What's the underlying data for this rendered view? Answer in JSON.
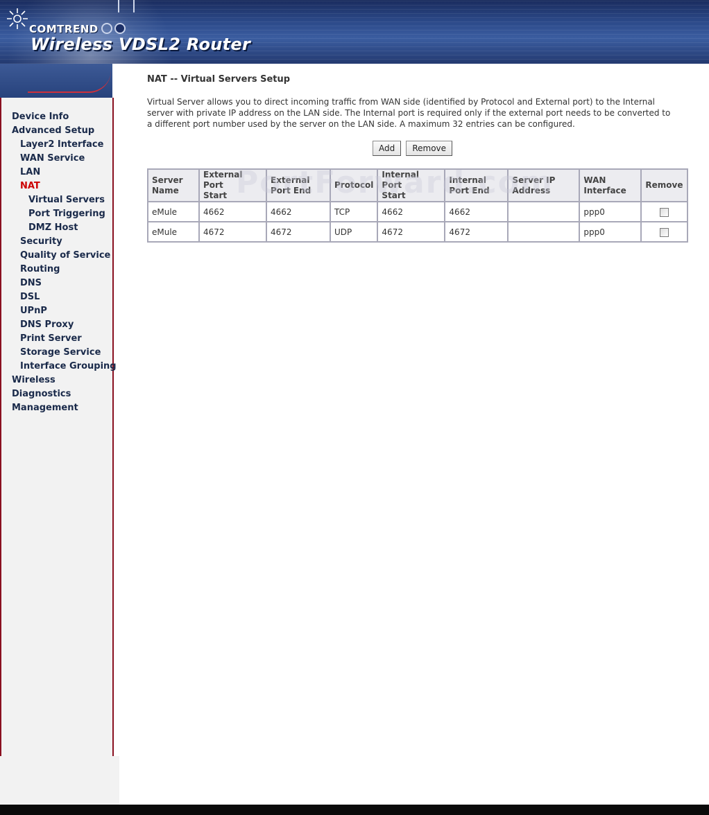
{
  "header": {
    "brand": "COMTREND",
    "product": "Wireless VDSL2 Router"
  },
  "sidebar": {
    "items": [
      {
        "label": "Device Info",
        "level": 1
      },
      {
        "label": "Advanced Setup",
        "level": 1
      },
      {
        "label": "Layer2 Interface",
        "level": 2
      },
      {
        "label": "WAN Service",
        "level": 2
      },
      {
        "label": "LAN",
        "level": 2
      },
      {
        "label": "NAT",
        "level": 2,
        "active": true
      },
      {
        "label": "Virtual Servers",
        "level": 3
      },
      {
        "label": "Port Triggering",
        "level": 3
      },
      {
        "label": "DMZ Host",
        "level": 3
      },
      {
        "label": "Security",
        "level": 2
      },
      {
        "label": "Quality of Service",
        "level": 2
      },
      {
        "label": "Routing",
        "level": 2
      },
      {
        "label": "DNS",
        "level": 2
      },
      {
        "label": "DSL",
        "level": 2
      },
      {
        "label": "UPnP",
        "level": 2
      },
      {
        "label": "DNS Proxy",
        "level": 2
      },
      {
        "label": "Print Server",
        "level": 2
      },
      {
        "label": "Storage Service",
        "level": 2
      },
      {
        "label": "Interface Grouping",
        "level": 2
      },
      {
        "label": "Wireless",
        "level": 1
      },
      {
        "label": "Diagnostics",
        "level": 1
      },
      {
        "label": "Management",
        "level": 1
      }
    ],
    "active_color": "#cc0000"
  },
  "main": {
    "title": "NAT -- Virtual Servers Setup",
    "description": "Virtual Server allows you to direct incoming traffic from WAN side (identified by Protocol and External port) to the Internal server with private IP address on the LAN side. The Internal port is required only if the external port needs to be converted to a different port number used by the server on the LAN side. A maximum 32 entries can be configured.",
    "buttons": {
      "add_label": "Add",
      "remove_label": "Remove"
    },
    "table": {
      "headers": [
        [
          "Server",
          "Name"
        ],
        [
          "External Port",
          "Start"
        ],
        [
          "External",
          "Port End"
        ],
        [
          "Protocol"
        ],
        [
          "Internal Port",
          "Start"
        ],
        [
          "Internal",
          "Port End"
        ],
        [
          "Server IP",
          "Address"
        ],
        [
          "WAN",
          "Interface"
        ],
        [
          "Remove"
        ]
      ],
      "rows": [
        {
          "server_name": "eMule",
          "ext_start": "4662",
          "ext_end": "4662",
          "protocol": "TCP",
          "int_start": "4662",
          "int_end": "4662",
          "server_ip": "",
          "wan_interface": "ppp0",
          "remove_checked": false
        },
        {
          "server_name": "eMule",
          "ext_start": "4672",
          "ext_end": "4672",
          "protocol": "UDP",
          "int_start": "4672",
          "int_end": "4672",
          "server_ip": "",
          "wan_interface": "ppp0",
          "remove_checked": false
        }
      ]
    }
  },
  "watermark": "PortForward.com"
}
